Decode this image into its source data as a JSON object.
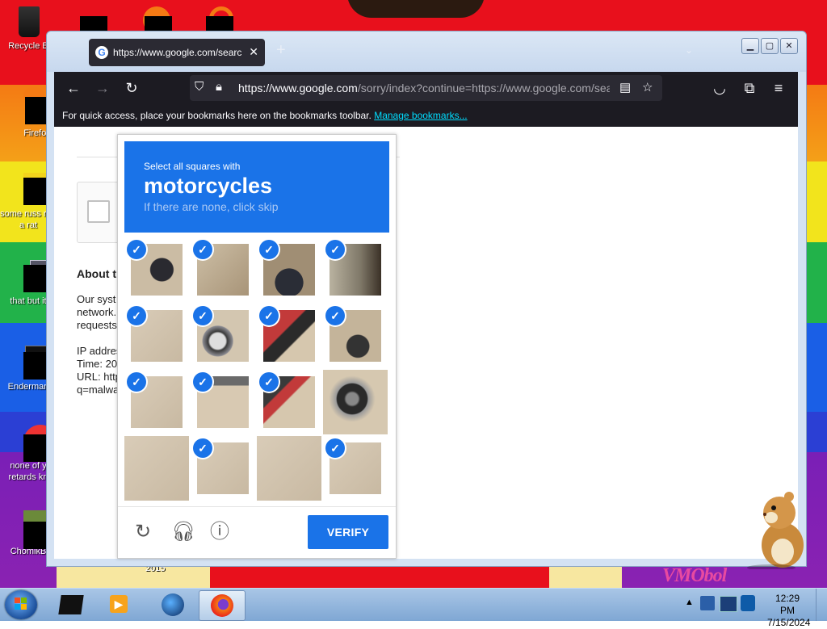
{
  "desktop": {
    "icons": [
      {
        "label": "Recycle B",
        "name": "desktop-icon-recycle-bin"
      },
      {
        "label": "Firefox",
        "name": "desktop-icon-firefox"
      },
      {
        "label": "some russ ran a rat",
        "name": "desktop-icon-some-russ"
      },
      {
        "label": "that but it",
        "name": "desktop-icon-that-but-it"
      },
      {
        "label": "Enderman",
        "name": "desktop-icon-enderman"
      },
      {
        "label": "none of y retards kn",
        "name": "desktop-icon-none-of-y"
      },
      {
        "label": "ChomikB",
        "name": "desktop-icon-chomikb"
      }
    ],
    "watermark": "VMObol",
    "wallpaper_year": "2015"
  },
  "browser": {
    "tab_title": "https://www.google.com/searc",
    "url_host": "https://www.google.com",
    "url_path": "/sorry/index?continue=https://www.google.com/sea",
    "bookmarks_hint": "For quick access, place your bookmarks here on the bookmarks toolbar.",
    "bookmarks_link": "Manage bookmarks..."
  },
  "page": {
    "about": "About th",
    "lines": [
      "Our syst",
      "network.",
      "requests"
    ],
    "ip": "IP addres",
    "time": "Time: 20",
    "url": "URL: http",
    "query": "q=malwa"
  },
  "captcha": {
    "instruction": "Select all squares with",
    "target": "motorcycles",
    "hint": "If there are none, click skip",
    "verify_label": "VERIFY",
    "tiles": [
      {
        "selected": true,
        "desc": "moto-rear"
      },
      {
        "selected": true,
        "desc": "ground-bench"
      },
      {
        "selected": true,
        "desc": "helmet"
      },
      {
        "selected": true,
        "desc": "wall"
      },
      {
        "selected": true,
        "desc": "ground"
      },
      {
        "selected": true,
        "desc": "moto-wheel"
      },
      {
        "selected": true,
        "desc": "moto-red"
      },
      {
        "selected": true,
        "desc": "moto-wheel-right"
      },
      {
        "selected": true,
        "desc": "ground"
      },
      {
        "selected": true,
        "desc": "ground-tire"
      },
      {
        "selected": true,
        "desc": "moto-body"
      },
      {
        "selected": false,
        "desc": "moto-wheel-large"
      },
      {
        "selected": false,
        "desc": "ground"
      },
      {
        "selected": true,
        "desc": "ground"
      },
      {
        "selected": false,
        "desc": "ground"
      },
      {
        "selected": true,
        "desc": "ground"
      }
    ]
  },
  "taskbar": {
    "time": "12:29 PM",
    "date": "7/15/2024"
  }
}
